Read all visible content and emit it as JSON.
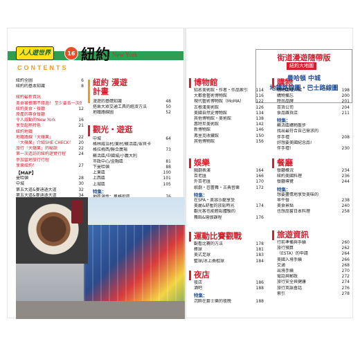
{
  "header": {
    "series": "人人遊世界",
    "vol": "16",
    "title": "紐約",
    "title_en": "New York",
    "contents": "CONTENTS"
  },
  "map_box": {
    "title": "街道漫遊隨帶版",
    "tag": "紐約大地圖",
    "line1": "曼哈頓 中城",
    "line2": "地鐵路線圖・巴士路線圖"
  },
  "col1": {
    "rows": [
      {
        "label": "紐約全圖",
        "page": "6"
      },
      {
        "label": "紐約的基本知識",
        "page": "8"
      }
    ],
    "rows_red": [
      {
        "label": "紐約最新資訊",
        "page": ""
      },
      {
        "label": "美食饕餮團不錯過！ 至少要去一次的",
        "page": ""
      },
      {
        "label": "紐約美食・餐廳",
        "page": "12"
      },
      {
        "label": "原產的專食餐廳",
        "page": ""
      },
      {
        "label": "令人威動的New York",
        "page": "16"
      },
      {
        "label": "享受超熱特色",
        "page": "21"
      },
      {
        "label": "紐約地鐵",
        "page": ""
      },
      {
        "label": "地鐵路線「大蘋果」",
        "page": "22"
      },
      {
        "label": "「大蘋果」介紹SHE CHECK！",
        "page": "20"
      },
      {
        "label": "旅行「大蘋果」的秘訣",
        "page": "22"
      },
      {
        "label": "第一次造訪的紐約遊覽行程",
        "page": "24"
      },
      {
        "label": "參加當地旅行行程",
        "page": ""
      },
      {
        "label": "享樂紐約！",
        "page": "27"
      }
    ],
    "map_head": "【MAP】",
    "map_rows": [
      {
        "label": "曼哈頓",
        "page": "28"
      },
      {
        "label": "中城",
        "page": "30"
      },
      {
        "label": "第五大道&麥迪遜大道",
        "page": "32"
      },
      {
        "label": "第五大道&麥迪遜大道",
        "page": "34"
      },
      {
        "label": "蘇活區・格林威治村",
        "page": "36"
      },
      {
        "label": "蘇活區・格林威治村/格林威治村",
        "page": "38"
      },
      {
        "label": "蘇活區→下曼哈頓",
        "page": "40"
      },
      {
        "label": "下曼哈頓",
        "page": "42"
      },
      {
        "label": "上城",
        "page": "44"
      },
      {
        "label": "上曼哈頓",
        "page": "106"
      },
      {
        "label": "布魯克林區",
        "page": "108"
      }
    ]
  },
  "sections_left": [
    {
      "title": "紐約 漫遊計畫",
      "color": "#f19a1b",
      "rows": [
        {
          "label": "漫遊的基礎知識",
          "page": "48"
        },
        {
          "label": "搭乘大眾交通工具的經濟方法",
          "page": "50"
        },
        {
          "label": "地鐵路線圖",
          "page": "52"
        }
      ]
    },
    {
      "title": "觀光・遊逛",
      "color": "#d51f2e",
      "rows": [
        {
          "label": "中城",
          "page": "64"
        },
        {
          "label": "格林威治村/東村/蘇活區/翠貝卡",
          "page": ""
        },
        {
          "label": "格拉梅西/聯合廣場",
          "page": "73"
        },
        {
          "label": "蘇活區/中國城/小義大利",
          "page": ""
        },
        {
          "label": "市政中心/金融區",
          "page": "81"
        },
        {
          "label": "下曼哈頓",
          "page": "88"
        },
        {
          "label": "上東區",
          "page": "100"
        },
        {
          "label": "上西區",
          "page": "101"
        },
        {
          "label": "上城區",
          "page": "105"
        }
      ],
      "special_head": "特集：",
      "special": [
        {
          "label": "地區漫步：風格街區",
          "page": "76"
        },
        {
          "label": "地區漫步：高線公園",
          "page": "78"
        },
        {
          "label": "地區漫步：下東區",
          "page": "86"
        },
        {
          "label": "自由女神像遊覽船！",
          "page": "90"
        },
        {
          "label": "地區漫步：威廉斯堡",
          "page": "92"
        },
        {
          "label": "地區漫步：中央公園",
          "page": "96"
        },
        {
          "label": "地區漫步：哈林 區之旅",
          "page": "109"
        },
        {
          "label": "紐約不可錯過的地標",
          "page": "110"
        }
      ]
    }
  ],
  "right_mid": [
    {
      "title": "博物館",
      "rows": [
        {
          "label": "知名美術館・作者・作品索引",
          "page": "114"
        },
        {
          "label": "大都會藝術博物館",
          "page": "116"
        },
        {
          "label": "現代藝術博物館（MoMA）",
          "page": "122"
        },
        {
          "label": "古根漢美術館",
          "page": "126"
        },
        {
          "label": "美國自然史博物館",
          "page": "134"
        },
        {
          "label": "其他博物館・美術館",
          "page": "138"
        },
        {
          "label": "惠特尼美術館",
          "page": "142"
        },
        {
          "label": "新博物館",
          "page": "146"
        },
        {
          "label": "弗里克收藏館",
          "page": "150"
        },
        {
          "label": "其他博物館",
          "page": "156"
        }
      ]
    },
    {
      "title": "娛樂",
      "rows": [
        {
          "label": "戲劇表演",
          "page": "164"
        },
        {
          "label": "百老匯",
          "page": "166"
        },
        {
          "label": "外百老匯",
          "page": "170"
        },
        {
          "label": "歌劇・芭蕾舞・古典音樂",
          "page": "172"
        }
      ],
      "special_head": "特集：",
      "special": [
        {
          "label": "在SPA・美容沙龍享受",
          "page": ""
        },
        {
          "label": "美麗&舒壓的放鬆時光",
          "page": "174"
        },
        {
          "label": "觀光客也能輕鬆體驗的",
          "page": ""
        },
        {
          "label": "舞蹈&瑜伽課程",
          "page": "176"
        }
      ]
    },
    {
      "title": "運動比賽觀戰",
      "rows": [
        {
          "label": "觀看比賽的方法",
          "page": "178"
        },
        {
          "label": "棒球",
          "page": "181"
        },
        {
          "label": "美式足球",
          "page": "183"
        },
        {
          "label": "籃球/冰上曲棍球",
          "page": "184"
        }
      ]
    },
    {
      "title": "夜店",
      "rows": [
        {
          "label": "夜店",
          "page": "186"
        },
        {
          "label": "酒吧",
          "page": "188"
        }
      ],
      "special_head": "特集：",
      "special": [
        {
          "label": "沉醉在爵士樂的夜晚",
          "page": "188"
        }
      ]
    }
  ],
  "right_right": [
    {
      "title": "購物",
      "rows": [
        {
          "label": "購物區域介紹",
          "page": "198"
        },
        {
          "label": "購物備忘",
          "page": "200"
        },
        {
          "label": "時尚品牌",
          "page": "201"
        },
        {
          "label": "百貨公司",
          "page": "204"
        },
        {
          "label": "食品雜貨店",
          "page": "211"
        }
      ],
      "special_head": "特集：",
      "special": [
        {
          "label": "蘇活區購物散步",
          "page": ""
        },
        {
          "label": "找出最符合自己需求的",
          "page": ""
        },
        {
          "label": "伴手禮",
          "page": "208"
        },
        {
          "label": "好想要美國紀念品!",
          "page": ""
        },
        {
          "label": "伴手禮!",
          "page": "230"
        }
      ]
    },
    {
      "title": "餐廳",
      "rows": [
        {
          "label": "餐廳概況",
          "page": "234"
        },
        {
          "label": "紐約美國料理",
          "page": "236"
        },
        {
          "label": "餐廳導覽",
          "page": "244"
        }
      ],
      "special_head": "特集：",
      "special": [
        {
          "label": "想要盡情地享受美味的",
          "page": ""
        },
        {
          "label": "早午餐",
          "page": "238"
        },
        {
          "label": "美食景點",
          "page": "240"
        },
        {
          "label": "也想品嘗日本料理",
          "page": "258"
        }
      ]
    },
    {
      "title": "旅遊資訊",
      "rows": [
        {
          "label": "行前準備與手續",
          "page": "260"
        },
        {
          "label": "旅行預算",
          "page": "262"
        },
        {
          "label": "（ESTA）的申請",
          "page": "264"
        },
        {
          "label": "美國入境手續",
          "page": "266"
        },
        {
          "label": "交通",
          "page": "268"
        },
        {
          "label": "出境手續",
          "page": "270"
        },
        {
          "label": "電話與郵政",
          "page": "272"
        },
        {
          "label": "旅行安全與健康",
          "page": "274"
        },
        {
          "label": "旅行英語會話",
          "page": "276"
        },
        {
          "label": "索引",
          "page": "278"
        }
      ]
    }
  ],
  "colors": {
    "accent_red": "#d51f2e",
    "accent_orange": "#f19a1b",
    "accent_green": "#2f9e55",
    "accent_blue": "#1f4d9a"
  }
}
